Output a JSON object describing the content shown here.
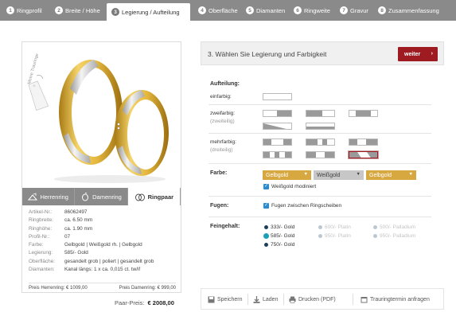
{
  "steps": [
    {
      "num": "1",
      "label": "Ringprofil"
    },
    {
      "num": "2",
      "label": "Breite / Höhe"
    },
    {
      "num": "3",
      "label": "Legierung / Aufteilung"
    },
    {
      "num": "4",
      "label": "Oberfläche"
    },
    {
      "num": "5",
      "label": "Diamanten"
    },
    {
      "num": "6",
      "label": "Ringweite"
    },
    {
      "num": "7",
      "label": "Gravur"
    },
    {
      "num": "8",
      "label": "Zusammenfassung"
    }
  ],
  "product": {
    "tag_text": "Meine Trauringe",
    "tabs": [
      {
        "label": "Herrenring",
        "icon": "men-ring-icon"
      },
      {
        "label": "Damenring",
        "icon": "women-ring-icon"
      },
      {
        "label": "Ringpaar",
        "icon": "ring-pair-icon"
      }
    ],
    "specs": [
      {
        "k": "Artikel-Nr.:",
        "v": "86062497"
      },
      {
        "k": "Ringbreite:",
        "v": "ca. 6.50 mm"
      },
      {
        "k": "Ringhöhe:",
        "v": "ca. 1.90 mm"
      },
      {
        "k": "Profil-Nr.:",
        "v": "07"
      },
      {
        "k": "Farbe:",
        "v": "Gelbgold | Weißgold rh. | Gelbgold"
      },
      {
        "k": "Legierung:",
        "v": "585/- Gold"
      },
      {
        "k": "Oberfläche:",
        "v": "gesandelt grob | poliert | gesandelt grob"
      },
      {
        "k": "Diamanten:",
        "v": "Kanal längs: 1 x ca. 0,015 ct. tw/if"
      }
    ],
    "price_men": "Preis Herrenring: € 1009,00",
    "price_women": "Preis Damenring: € 999,00",
    "pair_label": "Paar-Preis:",
    "pair_value": "€ 2008,00"
  },
  "config": {
    "title": "3. Wählen Sie Legierung und Farbigkeit",
    "next_label": "weiter",
    "aufteilung_label": "Aufteilung:",
    "einfarbig": "einfarbig:",
    "zweifarbig": "zweifarbig:",
    "zweiteilig": "(zweiteilig)",
    "mehrfarbig": "mehrfarbig:",
    "dreiteilig": "(dreiteilig)",
    "farbe_label": "Farbe:",
    "farbe_options": [
      "Gelbgold",
      "Weißgold",
      "Gelbgold"
    ],
    "rhodiniert": "Weißgold rhodiniert",
    "fugen_label": "Fugen:",
    "fugen_option": "Fugen zwischen Ringscheiben",
    "feingehalt_label": "Feingehalt:",
    "feingehalt": [
      {
        "label": "333/- Gold",
        "state": "normal"
      },
      {
        "label": "600/- Platin",
        "state": "dim"
      },
      {
        "label": "500/- Palladium",
        "state": "dim"
      },
      {
        "label": "585/- Gold",
        "state": "selected"
      },
      {
        "label": "950/- Platin",
        "state": "dim"
      },
      {
        "label": "950/- Palladium",
        "state": "dim"
      },
      {
        "label": "750/- Gold",
        "state": "normal"
      }
    ]
  },
  "footer": {
    "save": "Speichern",
    "load": "Laden",
    "print": "Drucken (PDF)",
    "appointment": "Trauringtermin anfragen"
  },
  "colors": {
    "accent": "#9e1b22",
    "gold": "#d7a840",
    "steps_bg": "#8a8a8a",
    "check": "#2a8ccf"
  }
}
